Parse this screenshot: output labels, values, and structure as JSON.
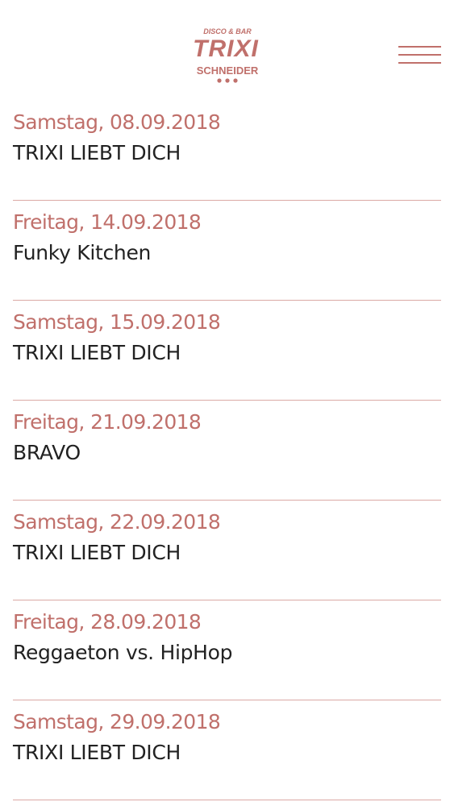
{
  "colors": {
    "accent": "#c0706b",
    "divider": "#dba9a5",
    "text": "#222222",
    "background": "#ffffff"
  },
  "header": {
    "logo": {
      "tagline": "DISCO & BAR",
      "name": "TRIXI",
      "subname": "SCHNEIDER"
    },
    "menu_icon": "hamburger-menu-icon"
  },
  "events": [
    {
      "date": "Samstag, 08.09.2018",
      "title": "TRIXI LIEBT DICH"
    },
    {
      "date": "Freitag, 14.09.2018",
      "title": "Funky Kitchen"
    },
    {
      "date": "Samstag, 15.09.2018",
      "title": "TRIXI LIEBT DICH"
    },
    {
      "date": "Freitag, 21.09.2018",
      "title": "BRAVO"
    },
    {
      "date": "Samstag, 22.09.2018",
      "title": "TRIXI LIEBT DICH"
    },
    {
      "date": "Freitag, 28.09.2018",
      "title": "Reggaeton vs. HipHop"
    },
    {
      "date": "Samstag, 29.09.2018",
      "title": "TRIXI LIEBT DICH"
    }
  ]
}
